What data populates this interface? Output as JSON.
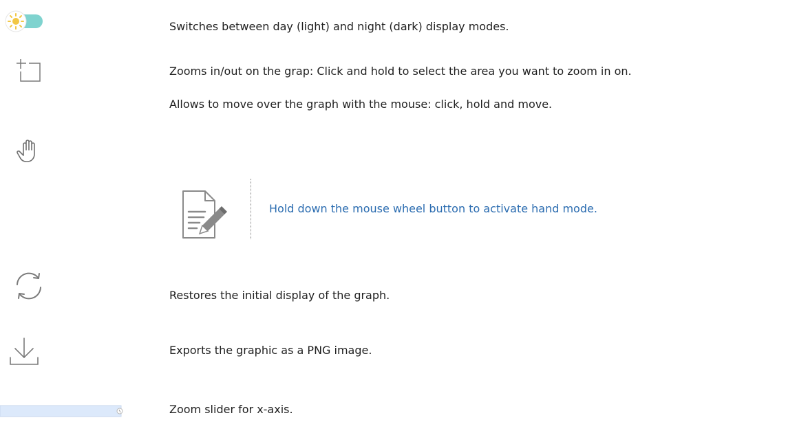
{
  "rows": [
    {
      "icon": "day-night-toggle-icon",
      "text": "Switches between day (light) and night (dark) display modes."
    },
    {
      "icon": "zoom-select-icon",
      "text": "Zooms in/out on the grap: Click and hold to select the area you want to zoom in on."
    },
    {
      "icon": "hand-pan-icon",
      "text": "Allows to move over the graph with the mouse: click, hold and move."
    },
    {
      "icon": "reset-refresh-icon",
      "text": "Restores the initial display of the graph."
    },
    {
      "icon": "download-icon",
      "text": "Exports the graphic as a PNG image."
    },
    {
      "icon": "zoom-slider-icon",
      "text": "Zoom slider for x-axis."
    }
  ],
  "note": {
    "icon": "note-pencil-icon",
    "text": "Hold down the mouse wheel button to activate hand mode."
  },
  "colors": {
    "note_text": "#2b6cb0",
    "toggle_track": "#7fd3cf",
    "toggle_sun": "#f2c744",
    "icon_gray": "#7a7a7a",
    "slider_fill": "#dce9fb"
  }
}
